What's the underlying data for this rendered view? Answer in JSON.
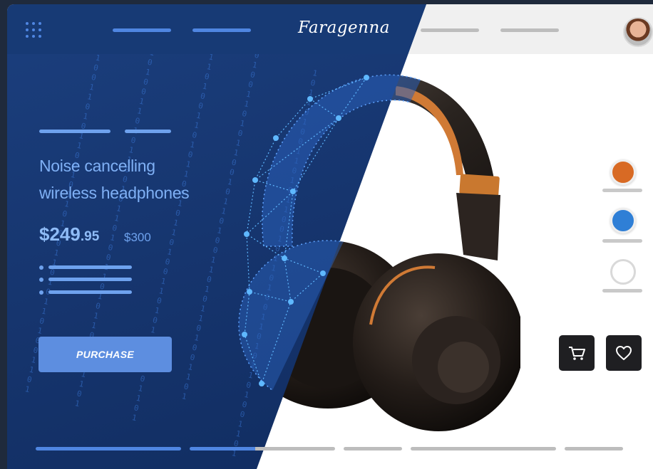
{
  "header": {
    "logo_text": "Faragenna",
    "menu_icon": "grid-dots-icon",
    "avatar_icon": "user-avatar-icon"
  },
  "product": {
    "title_line1": "Noise cancelling",
    "title_line2": "wireless headphones",
    "price_main": "$249",
    "price_cents": ".95",
    "old_price": "$300",
    "purchase_label": "PURCHASE"
  },
  "colors": {
    "accent_blue": "#5d8ee0",
    "panel_blue": "#173a75",
    "swatch_orange": "#d86a24",
    "swatch_blue": "#2f7fd6",
    "swatch_white": "#ffffff",
    "action_dark": "#1f1f22"
  },
  "swatches": [
    {
      "name": "orange",
      "color": "#d86a24"
    },
    {
      "name": "blue",
      "color": "#2f7fd6"
    },
    {
      "name": "white",
      "color": "#ffffff"
    }
  ],
  "actions": {
    "cart_icon": "cart-icon",
    "wishlist_icon": "heart-icon"
  },
  "binary_text": "1\n0\n1\n1\n0\n1\n0\n0\n1\n1\n0\n1\n0\n1\n1\n0\n0\n1\n0\n1\n1\n0\n1\n0\n0\n1\n1\n0\n1\n0\n1\n1\n0\n1\n0\n0\n1\n1\n0\n1"
}
